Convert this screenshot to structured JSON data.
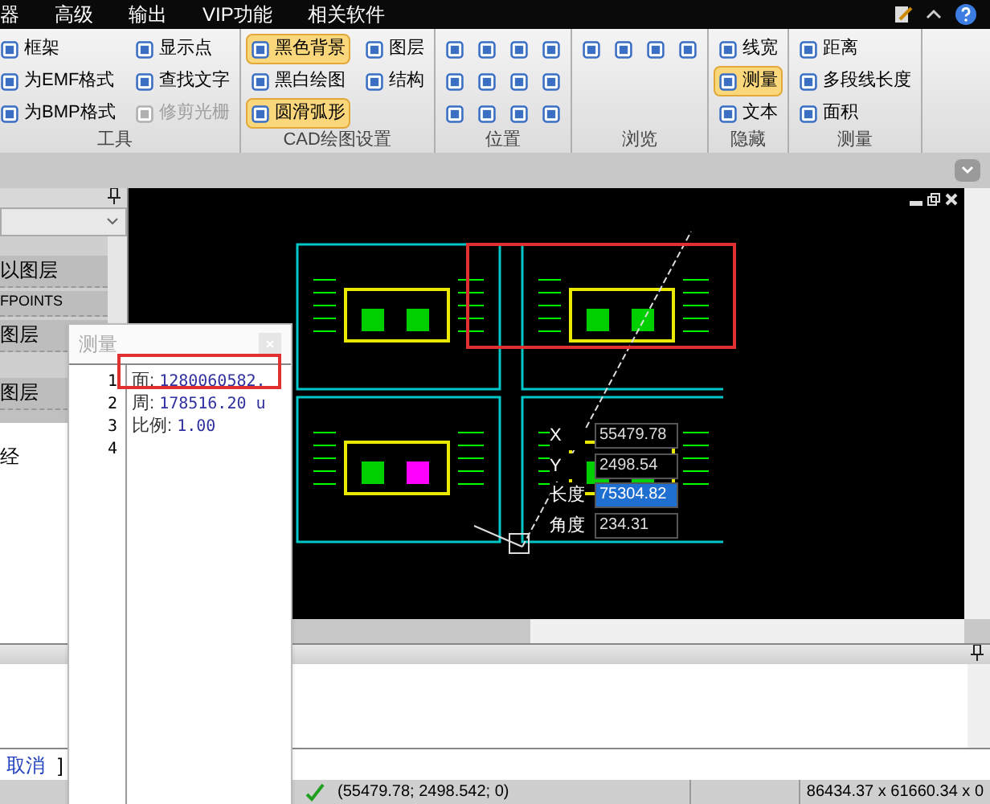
{
  "menu_bar": {
    "items": [
      "器",
      "高级",
      "输出",
      "VIP功能",
      "相关软件"
    ]
  },
  "ribbon": {
    "groups": [
      {
        "title": "工具",
        "kind": "buttons",
        "columns": [
          [
            {
              "label": "框架",
              "selected": false,
              "disabled": false
            },
            {
              "label": "为EMF格式",
              "selected": false,
              "disabled": false
            },
            {
              "label": "为BMP格式",
              "selected": false,
              "disabled": false
            }
          ],
          [
            {
              "label": "显示点",
              "selected": false,
              "disabled": false
            },
            {
              "label": "查找文字",
              "selected": false,
              "disabled": false
            },
            {
              "label": "修剪光栅",
              "selected": false,
              "disabled": true
            }
          ]
        ]
      },
      {
        "title": "CAD绘图设置",
        "kind": "buttons",
        "columns": [
          [
            {
              "label": "黑色背景",
              "selected": true,
              "disabled": false
            },
            {
              "label": "黑白绘图",
              "selected": false,
              "disabled": false
            },
            {
              "label": "圆滑弧形",
              "selected": true,
              "disabled": false
            }
          ],
          [
            {
              "label": "图层",
              "selected": false,
              "disabled": false
            },
            {
              "label": "结构",
              "selected": false,
              "disabled": false
            }
          ]
        ]
      },
      {
        "title": "位置",
        "kind": "position_icons"
      },
      {
        "title": "浏览",
        "kind": "browse_icons"
      },
      {
        "title": "隐藏",
        "kind": "buttons",
        "columns": [
          [
            {
              "label": "线宽",
              "selected": false,
              "disabled": false
            },
            {
              "label": "测量",
              "selected": true,
              "disabled": false
            },
            {
              "label": "文本",
              "selected": false,
              "disabled": false
            }
          ]
        ]
      },
      {
        "title": "测量",
        "kind": "buttons",
        "columns": [
          [
            {
              "label": "距离",
              "selected": false,
              "disabled": false
            },
            {
              "label": "多段线长度",
              "selected": false,
              "disabled": false
            },
            {
              "label": "面积",
              "selected": false,
              "disabled": false
            }
          ]
        ]
      }
    ]
  },
  "left_panel": {
    "items": [
      "以图层",
      "FPOINTS",
      "图层",
      "图层"
    ],
    "lower_text": "经"
  },
  "measure_window": {
    "title": "测量",
    "lines": [
      {
        "number": "1",
        "label": "面:",
        "value": "1280060582."
      },
      {
        "number": "2",
        "label": "周:",
        "value": "178516.20 u"
      },
      {
        "number": "3",
        "label": "比例:",
        "value": "1.00"
      },
      {
        "number": "4"
      }
    ]
  },
  "canvas": {
    "readout": [
      {
        "label": "X",
        "value": "55479.78",
        "selected": false
      },
      {
        "label": "Y",
        "value": "2498.54",
        "selected": false
      },
      {
        "label": "长度",
        "value": "75304.82",
        "selected": true
      },
      {
        "label": "角度",
        "value": "234.31",
        "selected": false
      }
    ]
  },
  "command_line": {
    "cancel": "取消",
    "bracket": "]"
  },
  "status_bar": {
    "coordinates": "(55479.78; 2498.542; 0)",
    "extents": "86434.37 x 61660.34 x 0"
  }
}
